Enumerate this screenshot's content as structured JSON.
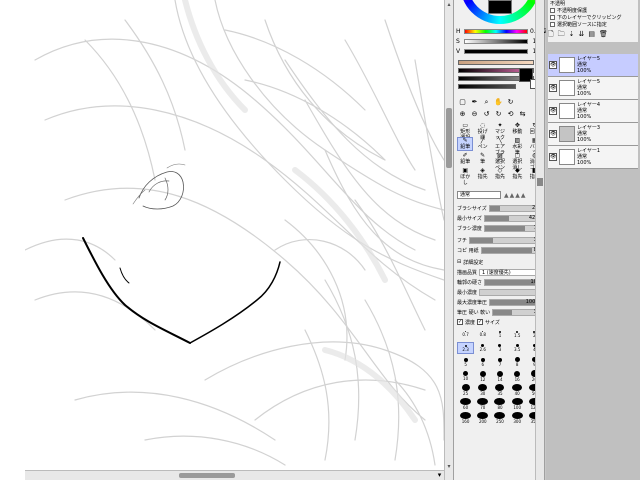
{
  "canvas": {
    "bg_color": "#ffffff",
    "sketch_color": "#cfcfcf",
    "lineart_color": "#000000"
  },
  "color_panel": {
    "h_label": "H",
    "h_value": "0.082",
    "s_label": "S",
    "s_value": "100",
    "v_label": "V",
    "v_value": "100"
  },
  "tools": [
    {
      "glyph": "▭",
      "label": "矩形選択"
    },
    {
      "glyph": "◌",
      "label": "投げ縄"
    },
    {
      "glyph": "✦",
      "label": "マジック"
    },
    {
      "glyph": "✥",
      "label": "移動"
    },
    {
      "glyph": "↻",
      "label": "回転"
    },
    {
      "glyph": "✎",
      "label": "鉛筆"
    },
    {
      "glyph": "╱",
      "label": "ペン"
    },
    {
      "glyph": "╲",
      "label": "エアブラシ"
    },
    {
      "glyph": "▨",
      "label": "水彩筆"
    },
    {
      "glyph": "▦",
      "label": "バケツ"
    },
    {
      "glyph": "✐",
      "label": "鉛筆"
    },
    {
      "glyph": "✎",
      "label": "筆"
    },
    {
      "glyph": "▤",
      "label": "選択ペン"
    },
    {
      "glyph": "▢",
      "label": "選択消し"
    },
    {
      "glyph": "◍",
      "label": "消しゴム"
    },
    {
      "glyph": "▣",
      "label": "ぼかし"
    },
    {
      "glyph": "◈",
      "label": "指先"
    },
    {
      "glyph": "◇",
      "label": "指先"
    },
    {
      "glyph": "◆",
      "label": "指先"
    },
    {
      "glyph": "◧",
      "label": "指先"
    }
  ],
  "brush": {
    "blend_mode": "通常",
    "size_label": "ブラシサイズ",
    "size_value": "2.0",
    "min_size_label": "最小サイズ",
    "min_size_value": "42%",
    "density_label": "ブラシ濃度",
    "density_value": "70",
    "shape_label": "フチ",
    "shape_value": "32",
    "texture_label": "コピ 用紙",
    "texture_value": "84",
    "advanced_label": "詳細設定",
    "quality_label": "描画品質",
    "quality_value": "1 (速度優先)",
    "edge_label": "輪郭の硬さ",
    "edge_value": "100",
    "min_density_label": "最小濃度",
    "min_density_value": "0",
    "max_pressure_label": "最大濃度筆圧",
    "max_pressure_value": "100%",
    "pressure_label": "筆圧 硬い 軟い",
    "pressure_value": "38",
    "pressure_density_label": "濃度",
    "pressure_size_label": "サイズ"
  },
  "brush_sizes": [
    "0.7",
    "0.8",
    "1",
    "1.5",
    "2",
    "2.3",
    "2.6",
    "3",
    "3.5",
    "4",
    "5",
    "6",
    "7",
    "8",
    "9",
    "10",
    "12",
    "14",
    "16",
    "20",
    "25",
    "30",
    "35",
    "40",
    "50",
    "60",
    "70",
    "80",
    "100",
    "120",
    "160",
    "200",
    "250",
    "300",
    "350"
  ],
  "layer_panel": {
    "opt1": "不透明度保護",
    "opt2": "下のレイヤーでクリッピング",
    "opt3": "選択範囲ソースに指定",
    "top_label": "不透明"
  },
  "layers": [
    {
      "name": "レイヤー5",
      "mode": "通常",
      "opacity": "100%",
      "thumb": "white",
      "selected": true
    },
    {
      "name": "レイヤー5",
      "mode": "通常",
      "opacity": "100%",
      "thumb": "white",
      "selected": false
    },
    {
      "name": "レイヤー4",
      "mode": "通常",
      "opacity": "100%",
      "thumb": "white",
      "selected": false
    },
    {
      "name": "レイヤー3",
      "mode": "通常",
      "opacity": "100%",
      "thumb": "gray",
      "selected": false
    },
    {
      "name": "レイヤー1",
      "mode": "通常",
      "opacity": "100%",
      "thumb": "white",
      "selected": false
    }
  ],
  "icons": {
    "layer_new": "new-layer-icon",
    "layer_folder": "folder-icon",
    "layer_delete": "trash-icon",
    "hand": "hand-icon",
    "zoom": "zoom-icon",
    "rotate": "rotate-icon"
  }
}
